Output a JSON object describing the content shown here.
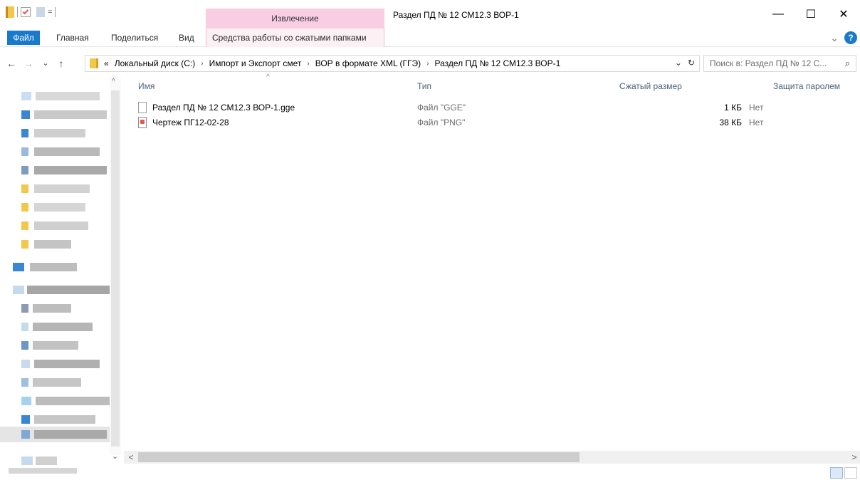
{
  "window": {
    "title": "Раздел ПД № 12 СМ12.3 ВОР-1",
    "context_group": "Извлечение",
    "controls": {
      "minimize": "—",
      "maximize": "☐",
      "close": "✕"
    }
  },
  "ribbon": {
    "tabs": [
      "Файл",
      "Главная",
      "Поделиться",
      "Вид"
    ],
    "context_tab": "Средства работы со сжатыми папками",
    "expand_glyph": "⌄",
    "help_glyph": "?"
  },
  "nav": {
    "back": "←",
    "forward": "→",
    "recent": "⌄",
    "up": "↑"
  },
  "address": {
    "overflow": "«",
    "crumbs": [
      "Локальный диск (C:)",
      "Импорт и Экспорт смет",
      "ВОР в формате XML (ГГЭ)",
      "Раздел ПД № 12 СМ12.3 ВОР-1"
    ],
    "crumb_sep": "›",
    "dropdown": "⌄",
    "refresh": "↻"
  },
  "search": {
    "placeholder": "Поиск в: Раздел ПД № 12 С...",
    "icon": "search-icon"
  },
  "columns": {
    "name": "Имя",
    "type": "Тип",
    "compressed": "Сжатый размер",
    "password": "Защита паролем",
    "sort_glyph": "^"
  },
  "files": [
    {
      "name": "Раздел ПД № 12 СМ12.3 ВОР-1.gge",
      "type": "Файл \"GGE\"",
      "size": "1 КБ",
      "password": "Нет",
      "icon": "file-icon"
    },
    {
      "name": "Чертеж ПГ12-02-28",
      "type": "Файл \"PNG\"",
      "size": "38 КБ",
      "password": "Нет",
      "icon": "image-file-icon"
    }
  ],
  "scroll": {
    "up": "^",
    "down": "⌄",
    "left": "<",
    "right": ">"
  },
  "colors": {
    "accent": "#1979ca",
    "context_tab": "#f9cde2",
    "header_text": "#4c607a"
  }
}
